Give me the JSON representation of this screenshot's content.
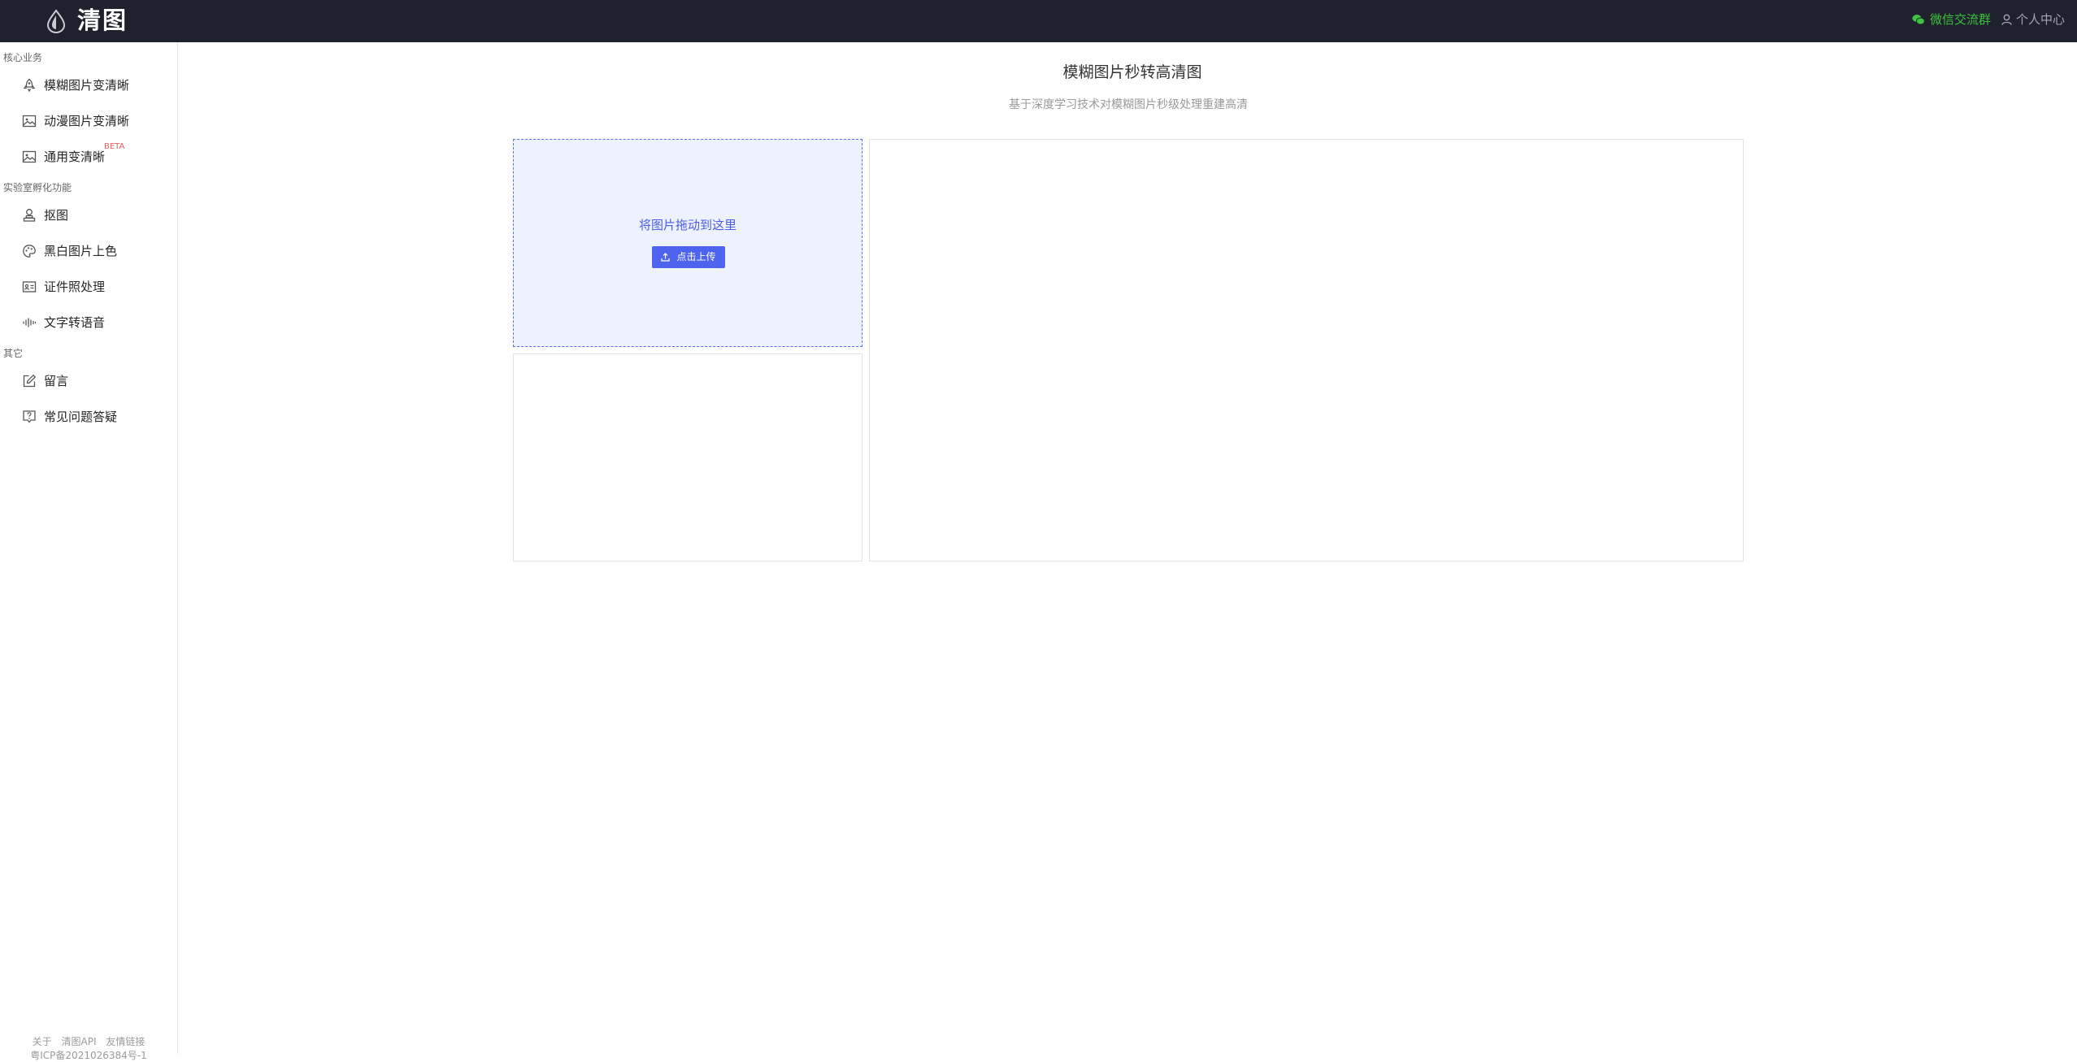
{
  "header": {
    "app_name": "清图",
    "wechat_label": "微信交流群",
    "user_label": "个人中心",
    "accent_color": "#3fc23f"
  },
  "sidebar": {
    "groups": [
      {
        "title": "核心业务",
        "items": [
          {
            "label": "模糊图片变清晰",
            "icon": "rocket-icon"
          },
          {
            "label": "动漫图片变清晰",
            "icon": "image-icon"
          },
          {
            "label": "通用变清晰",
            "icon": "image-icon",
            "badge": "BETA"
          }
        ]
      },
      {
        "title": "实验室孵化功能",
        "items": [
          {
            "label": "抠图",
            "icon": "person-icon"
          },
          {
            "label": "黑白图片上色",
            "icon": "palette-icon"
          },
          {
            "label": "证件照处理",
            "icon": "id-card-icon"
          },
          {
            "label": "文字转语音",
            "icon": "audio-wave-icon"
          }
        ]
      },
      {
        "title": "其它",
        "items": [
          {
            "label": "留言",
            "icon": "edit-icon"
          },
          {
            "label": "常见问题答疑",
            "icon": "question-icon"
          }
        ]
      }
    ],
    "footer": {
      "links": [
        "关于",
        "清图API",
        "友情链接"
      ],
      "icp": "粤ICP备2021026384号-1"
    }
  },
  "main": {
    "title": "模糊图片秒转高清图",
    "subtitle": "基于深度学习技术对模糊图片秒级处理重建高清",
    "upload": {
      "drop_hint": "将图片拖动到这里",
      "button_label": "点击上传",
      "accent_color": "#4f64ee"
    }
  }
}
